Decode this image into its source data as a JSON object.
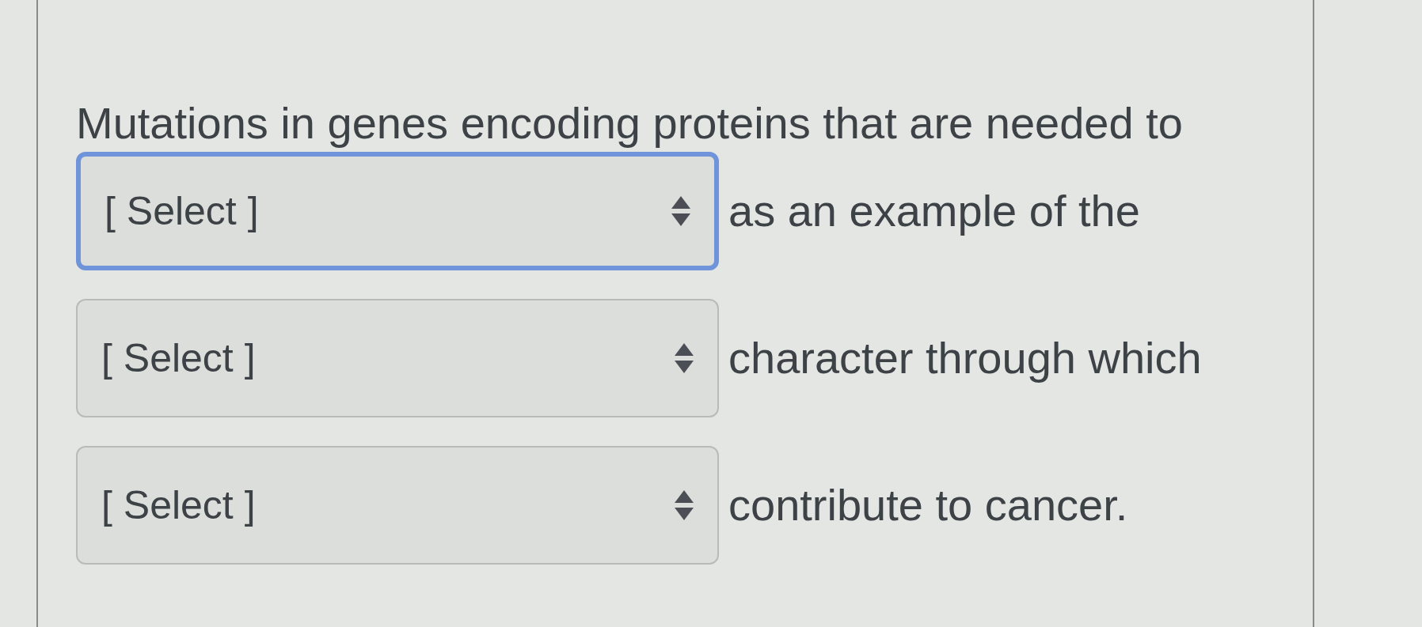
{
  "prompt": "Mutations in genes encoding proteins that are needed to",
  "blanks": [
    {
      "value": "[ Select ]",
      "focused": true,
      "after": "as an example of the"
    },
    {
      "value": "[ Select ]",
      "focused": false,
      "after": "character through which"
    },
    {
      "value": "[ Select ]",
      "focused": false,
      "after": "contribute to cancer."
    }
  ]
}
